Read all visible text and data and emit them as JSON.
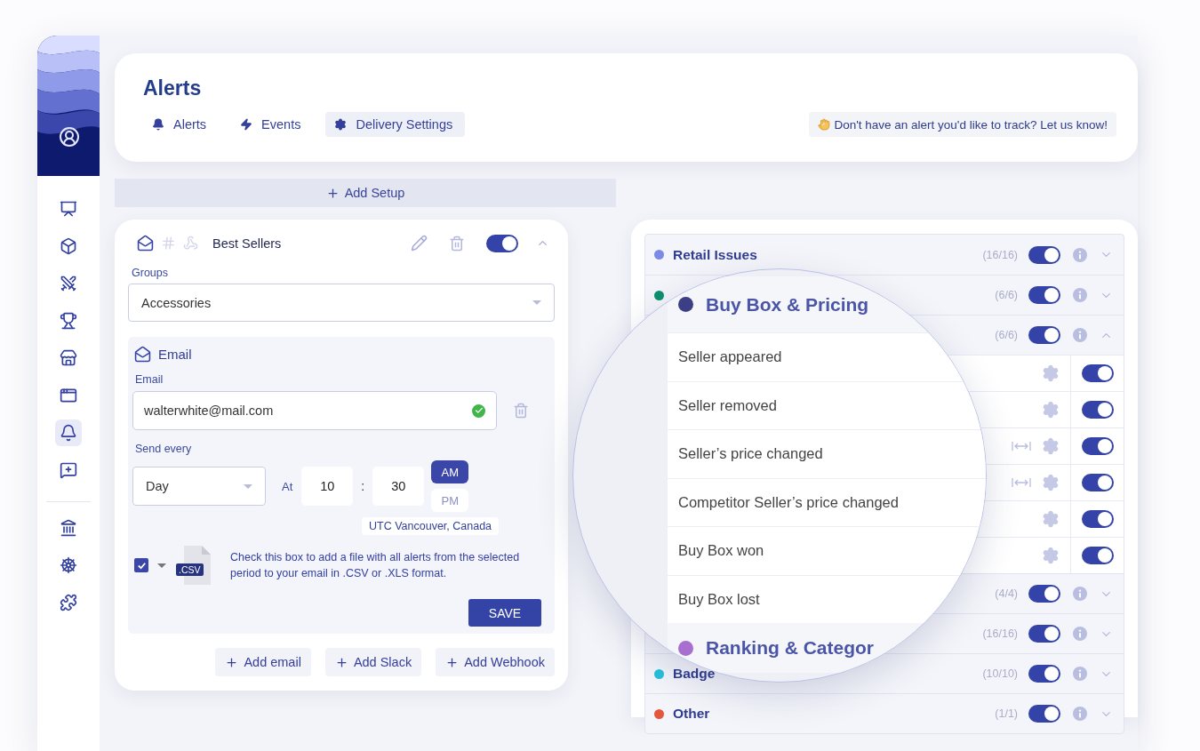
{
  "sidebar": {
    "items": [
      {
        "selected": false
      },
      {
        "selected": false
      },
      {
        "selected": false
      },
      {
        "selected": false
      },
      {
        "selected": false
      },
      {
        "selected": false
      },
      {
        "selected": true
      },
      {
        "selected": false
      }
    ],
    "bottom_items": [
      {
        "selected": false
      },
      {
        "selected": false
      },
      {
        "selected": false
      }
    ]
  },
  "header": {
    "title": "Alerts",
    "tabs": [
      {
        "label": "Alerts",
        "selected": false
      },
      {
        "label": "Events",
        "selected": false
      },
      {
        "label": "Delivery Settings",
        "selected": true
      }
    ],
    "notice": "Don't have an alert you'd like to track? Let us know!"
  },
  "add_setup": "Add Setup",
  "setup": {
    "name": "Best Sellers",
    "enabled": true,
    "expanded": true,
    "groups_label": "Groups",
    "group": "Accessories",
    "channel": {
      "title": "Email",
      "email_label": "Email",
      "email": "walterwhite@mail.com",
      "valid": true,
      "send_every_label": "Send every",
      "frequency": "Day",
      "at_label": "At",
      "hour": "10",
      "separator": ":",
      "minute": "30",
      "periods": [
        {
          "label": "AM",
          "selected": true
        },
        {
          "label": "PM",
          "selected": false
        }
      ],
      "timezone": "UTC Vancouver, Canada",
      "attach_file": true,
      "file_badge": ".CSV",
      "attach_note": "Check this box to add a file with all alerts from the selected period to your email in .CSV or .XLS format.",
      "save": "SAVE"
    },
    "add_buttons": [
      "Add email",
      "Add Slack",
      "Add Webhook"
    ]
  },
  "categories": [
    {
      "label": "Retail Issues",
      "color": "#7b8ae6",
      "count": "(16/16)",
      "on": true,
      "expanded": false
    },
    {
      "color": "#0e8f6e",
      "count": "(6/6)",
      "on": true,
      "expanded": false
    },
    {
      "count": "(6/6)",
      "on": true,
      "expanded": true,
      "alerts": [
        {
          "on": true,
          "range": false
        },
        {
          "on": true,
          "range": false
        },
        {
          "on": true,
          "range": true
        },
        {
          "on": true,
          "range": true
        },
        {
          "on": true,
          "range": false
        },
        {
          "on": true,
          "range": false
        }
      ]
    },
    {
      "count": "(4/4)",
      "on": true,
      "expanded": false
    },
    {
      "count": "(16/16)",
      "on": true,
      "expanded": false
    },
    {
      "label": "Badge",
      "color": "#26c0dc",
      "count": "(10/10)",
      "on": true,
      "expanded": false
    },
    {
      "label": "Other",
      "color": "#e4573b",
      "count": "(1/1)",
      "on": true,
      "expanded": false
    }
  ],
  "magnifier": {
    "category": {
      "label": "Buy Box & Pricing",
      "color": "#3d3f86"
    },
    "alerts": [
      "Seller appeared",
      "Seller removed",
      "Seller’s price changed",
      "Competitor Seller’s price changed",
      "Buy Box won",
      "Buy Box lost"
    ],
    "next_category": {
      "label": "Ranking & Categor",
      "color": "#a86fd0"
    }
  }
}
